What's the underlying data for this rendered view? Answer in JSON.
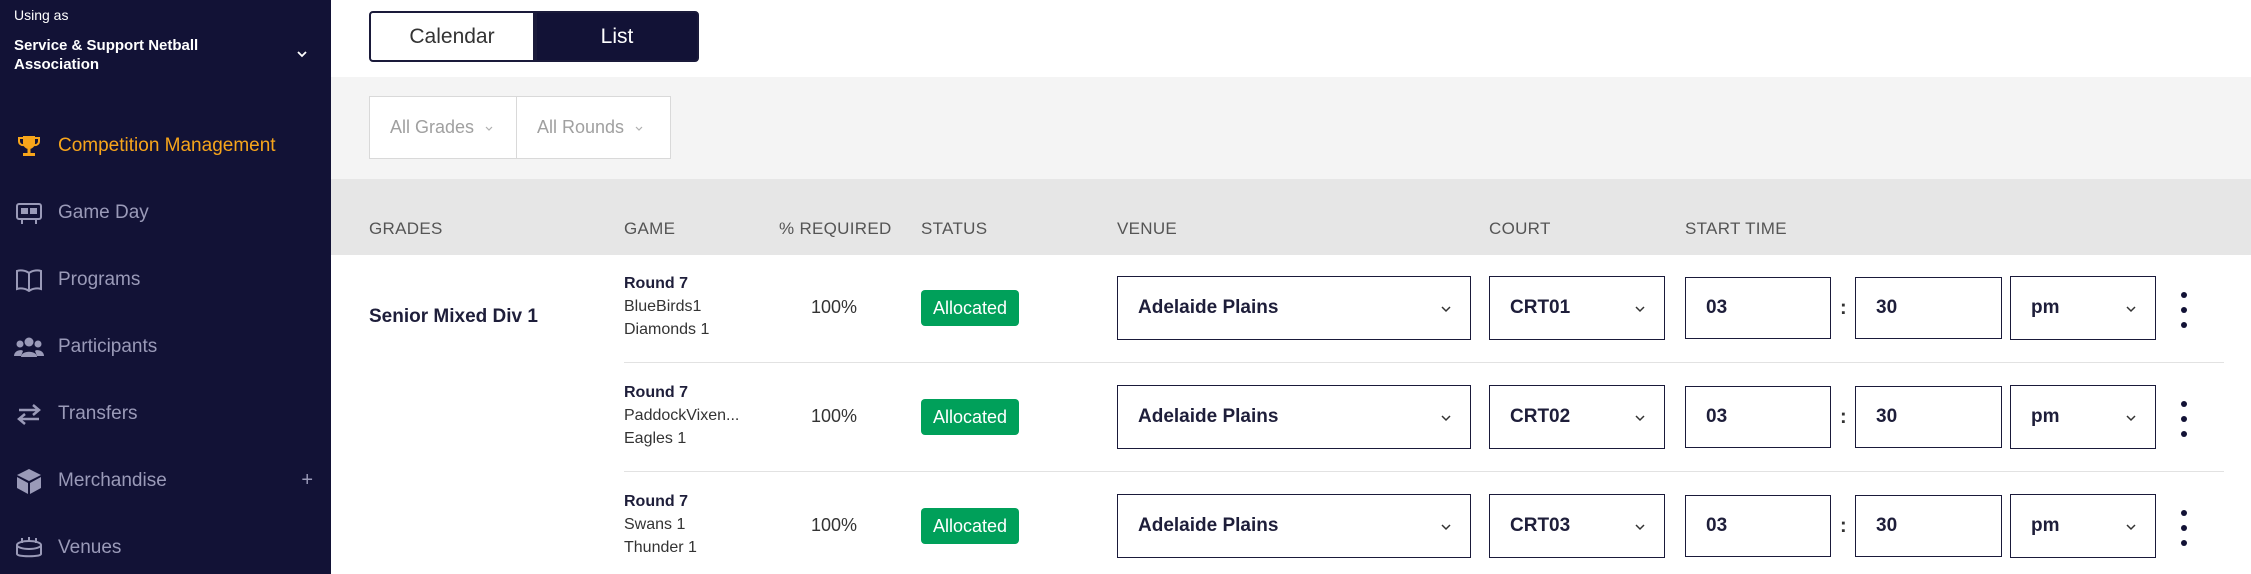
{
  "org": {
    "using_as": "Using as",
    "name": "Service & Support Netball Association"
  },
  "nav": {
    "items": [
      {
        "label": "Competition Management",
        "icon": "trophy-icon",
        "active": true
      },
      {
        "label": "Game Day",
        "icon": "scoreboard-icon"
      },
      {
        "label": "Programs",
        "icon": "book-icon"
      },
      {
        "label": "Participants",
        "icon": "people-icon"
      },
      {
        "label": "Transfers",
        "icon": "transfer-arrows-icon"
      },
      {
        "label": "Merchandise",
        "icon": "box-icon",
        "expand": "+"
      },
      {
        "label": "Venues",
        "icon": "stadium-icon"
      }
    ]
  },
  "view_toggle": {
    "calendar": "Calendar",
    "list": "List"
  },
  "filters": {
    "grades": "All Grades",
    "rounds": "All Rounds"
  },
  "table": {
    "headers": {
      "grades": "GRADES",
      "game": "GAME",
      "required": "% REQUIRED",
      "status": "STATUS",
      "venue": "VENUE",
      "court": "COURT",
      "start_time": "START TIME"
    },
    "grade": "Senior Mixed Div 1",
    "rows": [
      {
        "round": "Round 7",
        "team1": "BlueBirds1",
        "team2": "Diamonds 1",
        "required": "100%",
        "status": "Allocated",
        "venue": "Adelaide Plains",
        "court": "CRT01",
        "hour": "03",
        "minute": "30",
        "ampm": "pm"
      },
      {
        "round": "Round 7",
        "team1": "PaddockVixen...",
        "team2": "Eagles 1",
        "required": "100%",
        "status": "Allocated",
        "venue": "Adelaide Plains",
        "court": "CRT02",
        "hour": "03",
        "minute": "30",
        "ampm": "pm"
      },
      {
        "round": "Round 7",
        "team1": "Swans 1",
        "team2": "Thunder 1",
        "required": "100%",
        "status": "Allocated",
        "venue": "Adelaide Plains",
        "court": "CRT03",
        "hour": "03",
        "minute": "30",
        "ampm": "pm"
      }
    ],
    "time_separator": ":"
  },
  "colors": {
    "sidebar_bg": "#121236",
    "accent": "#f7a51b",
    "allocated": "#00a05a"
  }
}
